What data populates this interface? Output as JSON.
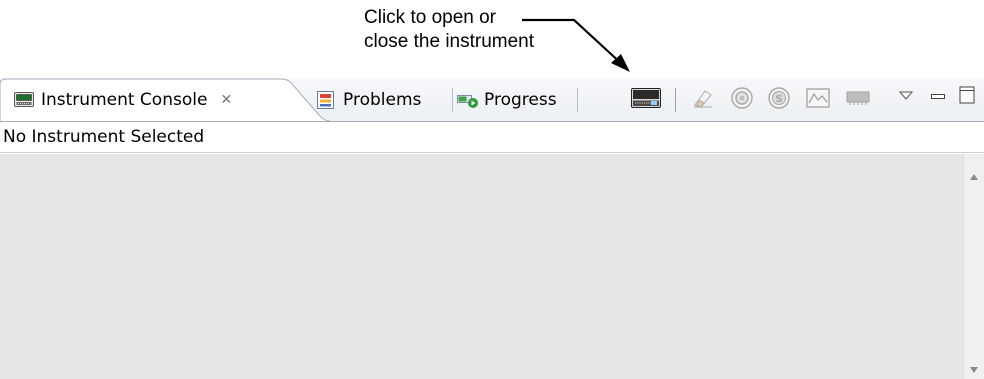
{
  "annotation": {
    "line1": "Click to open or",
    "line2": "close the instrument"
  },
  "tabs": [
    {
      "label": "Instrument Console",
      "icon": "instrument-console-icon",
      "active": true,
      "close": "✕"
    },
    {
      "label": "Problems",
      "icon": "problems-icon",
      "active": false
    },
    {
      "label": "Progress",
      "icon": "progress-icon",
      "active": false
    }
  ],
  "toolbar": {
    "items": [
      "open-close-instrument-icon",
      "clear-icon",
      "record-icon",
      "stop-icon",
      "chart-icon",
      "memory-icon",
      "view-menu-icon",
      "minimize-icon",
      "maximize-icon"
    ]
  },
  "status": {
    "text": "No Instrument Selected"
  },
  "colors": {
    "console_bg": "#e6e6e6",
    "tab_border": "#a6acb4",
    "accent_green": "#2f9a3a"
  }
}
